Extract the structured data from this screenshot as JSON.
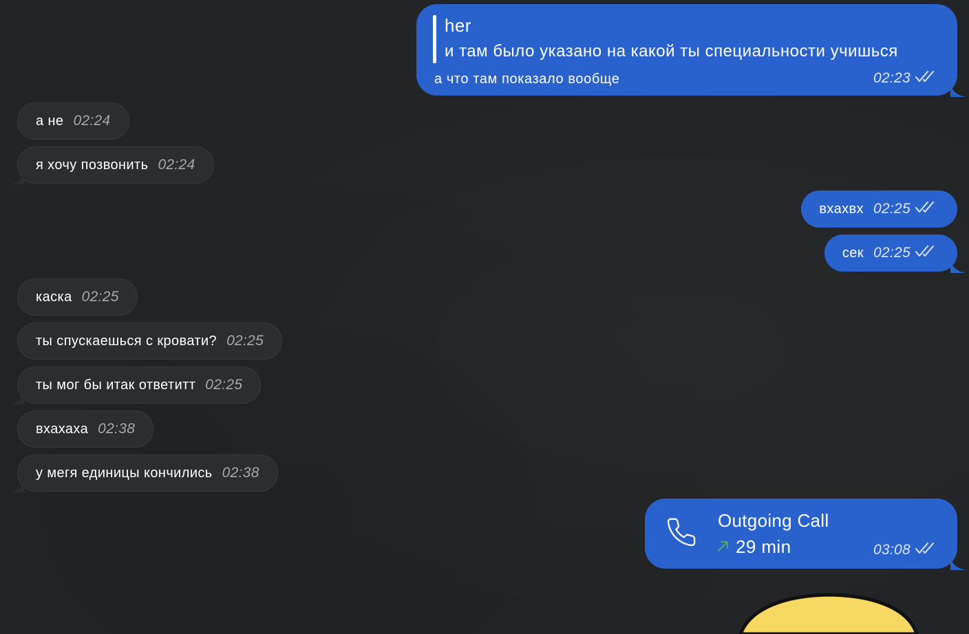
{
  "colors": {
    "background": "#222426",
    "incoming_bubble": "#2c2d2f",
    "outgoing_bubble": "#2962cc",
    "call_arrow": "#4caf50",
    "sticker": "#f7d862"
  },
  "messages": {
    "reply": {
      "quoted_name": "her",
      "quoted_text": "и там было указано на какой ты специальности учишься",
      "text": "а что там показало вообще",
      "time": "02:23"
    },
    "m1": {
      "text": "а не",
      "time": "02:24"
    },
    "m2": {
      "text": "я хочу позвонить",
      "time": "02:24"
    },
    "m3": {
      "text": "вхахвх",
      "time": "02:25"
    },
    "m4": {
      "text": "сек",
      "time": "02:25"
    },
    "m5": {
      "text": "каска",
      "time": "02:25"
    },
    "m6": {
      "text": "ты спускаешься с кровати?",
      "time": "02:25"
    },
    "m7": {
      "text": "ты мог бы итак ответитт",
      "time": "02:25"
    },
    "m8": {
      "text": "вхахаха",
      "time": "02:38"
    },
    "m9": {
      "text": "у мегя единицы кончились",
      "time": "02:38"
    },
    "call": {
      "title": "Outgoing Call",
      "duration": "29 min",
      "time": "03:08",
      "icon": "phone-icon",
      "direction_icon": "outgoing-arrow-icon"
    }
  }
}
